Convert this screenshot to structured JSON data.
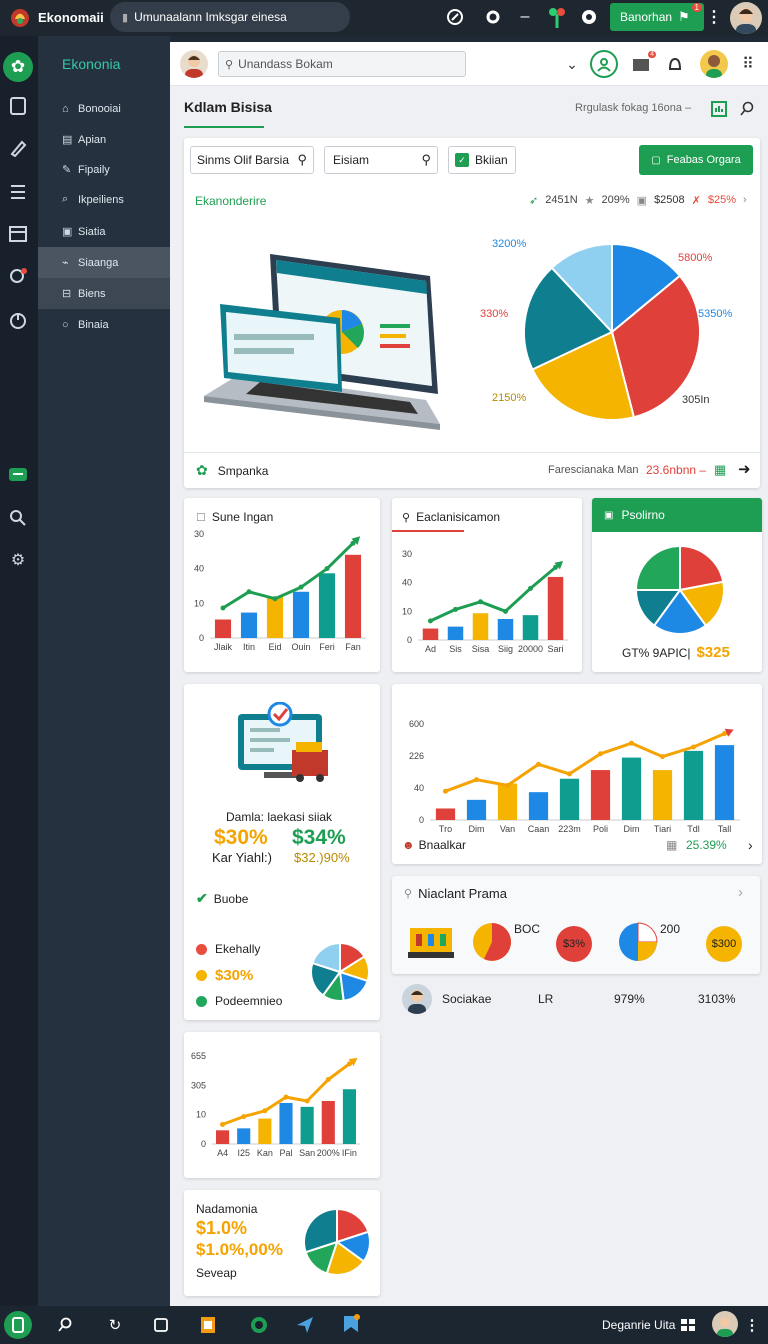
{
  "app": {
    "name": "Ekonomaii"
  },
  "topbar": {
    "tab_title": "Umunaalann Imksgar einesa",
    "action_button": "Banorhan",
    "notif_count": "1"
  },
  "sidebar": {
    "brand": "Ekononia",
    "items": [
      {
        "label": "Bonooiai",
        "icon": "home-icon"
      },
      {
        "label": "Apian",
        "icon": "doc-icon"
      },
      {
        "label": "Fipaily",
        "icon": "edit-icon"
      },
      {
        "label": "Ikpeiliens",
        "icon": "pin-icon"
      },
      {
        "label": "Siatia",
        "icon": "box-icon"
      },
      {
        "label": "Siaanga",
        "icon": "link-icon"
      },
      {
        "label": "Biens",
        "icon": "grid-icon"
      },
      {
        "label": "Binaia",
        "icon": "circle-icon"
      }
    ]
  },
  "header": {
    "search_placeholder": "Unandass Bokam",
    "notif_badge": "4"
  },
  "page": {
    "title": "Kdlam Bisisa",
    "subtitle": "Rrgulask fokag 16ona –"
  },
  "filters": {
    "search1": "Sinms Olif Barsia",
    "search2": "Eisiam",
    "chip": "Bkiian",
    "primary_button": "Feabas Orgara"
  },
  "hero": {
    "label": "Ekanonderire",
    "stats": [
      "2451N",
      "209%",
      "$2508",
      "$25%"
    ],
    "footer_label": "Smpanka",
    "footer_right_label": "Farescianaka Man",
    "footer_value": "23.6nbnn –",
    "pie_labels": [
      "3200%",
      "5800%",
      "330%",
      "5350%",
      "2150%",
      "305In"
    ]
  },
  "card_a": {
    "title": "Sune Ingan",
    "yticks": [
      "30",
      "40",
      "10",
      "0"
    ],
    "xticks": [
      "Jlaik",
      "Itin",
      "Eid",
      "Ouin",
      "Feri",
      "Fan"
    ]
  },
  "card_b": {
    "title": "Eaclanisicamon",
    "yticks": [
      "30",
      "40",
      "10",
      "0"
    ],
    "xticks": [
      "Ad",
      "Sis",
      "Sisa",
      "Siig",
      "20000",
      "Sari"
    ]
  },
  "card_c": {
    "title": "Psolirno",
    "footer_text": "GT% 9APIC|",
    "footer_value": "$325"
  },
  "promo": {
    "title": "Damla: laekasi siiak",
    "left_value": "$30%",
    "left_sub": "Kar Yiahl:)",
    "right_value": "$34%",
    "right_sub": "$32.)90%",
    "check_label": "Buobe"
  },
  "legend": [
    {
      "label": "Ekehally",
      "color": "#e84d3d"
    },
    {
      "label": "$30%",
      "color": "#f4b400"
    },
    {
      "label": "Podeemnieo",
      "color": "#22a65a"
    }
  ],
  "card_d": {
    "yticks": [
      "600",
      "226",
      "40",
      "0"
    ],
    "xticks": [
      "Tro",
      "Dim",
      "Van",
      "Caan",
      "223m",
      "Poli",
      "Dim",
      "Tiari",
      "Tdl",
      "Tall"
    ],
    "footer_label": "Bnaalkar",
    "footer_value": "25.39%"
  },
  "card_e": {
    "title": "Niaclant Prama",
    "items": [
      "BOC",
      "$3%",
      "200",
      "$300"
    ]
  },
  "social": {
    "name": "Sociakae",
    "col1": "LR",
    "col2": "979%",
    "col3": "3103%"
  },
  "card_f": {
    "yticks": [
      "655",
      "305",
      "10",
      "0"
    ],
    "xticks": [
      "A4",
      "I25",
      "Kan",
      "Pal",
      "San",
      "200%",
      "IFin"
    ]
  },
  "card_g": {
    "title": "Nadamonia",
    "value1": "$1.0%",
    "value2": "$1.0%,00%",
    "sub": "Seveap"
  },
  "taskbar": {
    "right_label": "Deganrie Uita"
  },
  "chart_data": [
    {
      "type": "pie",
      "title": "",
      "values": [
        14,
        32,
        22,
        20,
        12
      ],
      "colors": [
        "#1e88e5",
        "#e0403a",
        "#f4b400",
        "#0f7f8f",
        "#8fd0f0"
      ]
    },
    {
      "type": "bar",
      "title": "Sune Ingan",
      "categories": [
        "Jlaik",
        "Itin",
        "Eid",
        "Ouin",
        "Feri",
        "Fan"
      ],
      "series": [
        {
          "values": [
            8,
            11,
            18,
            20,
            28,
            36
          ]
        }
      ],
      "line": [
        13,
        20,
        17,
        22,
        30,
        41
      ],
      "ylim": [
        0,
        45
      ]
    },
    {
      "type": "bar",
      "title": "Eaclanisicamon",
      "categories": [
        "Ad",
        "Sis",
        "Sisa",
        "Siig",
        "20000",
        "Sari"
      ],
      "series": [
        {
          "values": [
            6,
            7,
            14,
            11,
            13,
            33
          ]
        }
      ],
      "line": [
        10,
        16,
        20,
        15,
        27,
        38
      ],
      "ylim": [
        0,
        45
      ]
    },
    {
      "type": "pie",
      "title": "Psolirno",
      "values": [
        22,
        18,
        20,
        15,
        25
      ],
      "colors": [
        "#e0403a",
        "#f4b400",
        "#1e88e5",
        "#0f7f8f",
        "#22a65a"
      ]
    },
    {
      "type": "bar",
      "title": "",
      "categories": [
        "Tro",
        "Dim",
        "Van",
        "Caan",
        "223m",
        "Poli",
        "Dim",
        "Tiari",
        "Tdl",
        "Tall"
      ],
      "series": [
        {
          "values": [
            120,
            210,
            380,
            290,
            430,
            520,
            650,
            520,
            720,
            780
          ]
        }
      ],
      "line": [
        300,
        420,
        360,
        580,
        480,
        690,
        800,
        660,
        760,
        900
      ],
      "ylim": [
        0,
        1000
      ]
    },
    {
      "type": "pie",
      "title": "",
      "values": [
        16,
        14,
        18,
        12,
        20,
        20
      ],
      "colors": [
        "#e0403a",
        "#f4b400",
        "#1e88e5",
        "#22a65a",
        "#0f7f8f",
        "#8fd0f0"
      ]
    },
    {
      "type": "bar",
      "title": "",
      "categories": [
        "A4",
        "I25",
        "Kan",
        "Pal",
        "San",
        "200%",
        "IFin"
      ],
      "series": [
        {
          "values": [
            7,
            8,
            13,
            21,
            19,
            22,
            28
          ]
        }
      ],
      "line": [
        10,
        14,
        17,
        24,
        22,
        33,
        41
      ],
      "ylim": [
        0,
        45
      ]
    },
    {
      "type": "pie",
      "title": "",
      "values": [
        20,
        15,
        20,
        15,
        30
      ],
      "colors": [
        "#e0403a",
        "#1e88e5",
        "#f4b400",
        "#22a65a",
        "#0f7f8f"
      ]
    }
  ]
}
